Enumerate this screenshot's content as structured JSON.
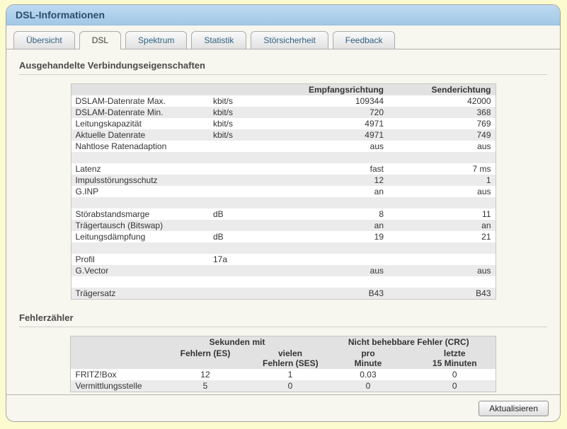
{
  "window": {
    "title": "DSL-Informationen"
  },
  "tabs": [
    {
      "label": "Übersicht",
      "active": false
    },
    {
      "label": "DSL",
      "active": true
    },
    {
      "label": "Spektrum",
      "active": false
    },
    {
      "label": "Statistik",
      "active": false
    },
    {
      "label": "Störsicherheit",
      "active": false
    },
    {
      "label": "Feedback",
      "active": false
    }
  ],
  "sections": {
    "connection": {
      "heading": "Ausgehandelte Verbindungseigenschaften",
      "table": {
        "column_headers": {
          "rx": "Empfangsrichtung",
          "tx": "Senderichtung"
        },
        "rows": [
          {
            "name": "DSLAM-Datenrate Max.",
            "unit": "kbit/s",
            "rx": "109344",
            "tx": "42000"
          },
          {
            "name": "DSLAM-Datenrate Min.",
            "unit": "kbit/s",
            "rx": "720",
            "tx": "368"
          },
          {
            "name": "Leitungskapazität",
            "unit": "kbit/s",
            "rx": "4971",
            "tx": "769"
          },
          {
            "name": "Aktuelle Datenrate",
            "unit": "kbit/s",
            "rx": "4971",
            "tx": "749"
          },
          {
            "name": "Nahtlose Ratenadaption",
            "unit": "",
            "rx": "aus",
            "tx": "aus"
          },
          {
            "spacer": true
          },
          {
            "name": "Latenz",
            "unit": "",
            "rx": "fast",
            "tx": "7 ms"
          },
          {
            "name": "Impulsstörungsschutz",
            "unit": "",
            "rx": "12",
            "tx": "1"
          },
          {
            "name": "G.INP",
            "unit": "",
            "rx": "an",
            "tx": "aus"
          },
          {
            "spacer": true
          },
          {
            "name": "Störabstandsmarge",
            "unit": "dB",
            "rx": "8",
            "tx": "11"
          },
          {
            "name": "Trägertausch (Bitswap)",
            "unit": "",
            "rx": "an",
            "tx": "an"
          },
          {
            "name": "Leitungsdämpfung",
            "unit": "dB",
            "rx": "19",
            "tx": "21"
          },
          {
            "spacer": true
          },
          {
            "name": "Profil",
            "unit": "17a",
            "rx": "",
            "tx": ""
          },
          {
            "name": "G.Vector",
            "unit": "",
            "rx": "aus",
            "tx": "aus"
          },
          {
            "spacer": true
          },
          {
            "name": "Trägersatz",
            "unit": "",
            "rx": "B43",
            "tx": "B43"
          }
        ]
      }
    },
    "errors": {
      "heading": "Fehlerzähler",
      "table": {
        "group_headers": [
          "Sekunden mit",
          "Nicht behebbare Fehler (CRC)"
        ],
        "col_headers": [
          {
            "line1": "Fehlern (ES)",
            "line2": ""
          },
          {
            "line1": "vielen",
            "line2": "Fehlern (SES)"
          },
          {
            "line1": "pro",
            "line2": "Minute"
          },
          {
            "line1": "letzte",
            "line2": "15 Minuten"
          }
        ],
        "rows": [
          {
            "name": "FRITZ!Box",
            "values": [
              "12",
              "1",
              "0.03",
              "0"
            ]
          },
          {
            "name": "Vermittlungsstelle",
            "values": [
              "5",
              "0",
              "0",
              "0"
            ]
          }
        ]
      }
    }
  },
  "footer": {
    "refresh_label": "Aktualisieren"
  },
  "colors": {
    "page_background": "#FBFBCF",
    "panel_background": "#F7F6EF",
    "titlebar_blue": "#A9CEE9",
    "title_text": "#2B4D6E",
    "tab_text": "#2F6183",
    "row_alt_gray": "#EBEBEB",
    "table_header_gray": "#E2E2E2"
  }
}
